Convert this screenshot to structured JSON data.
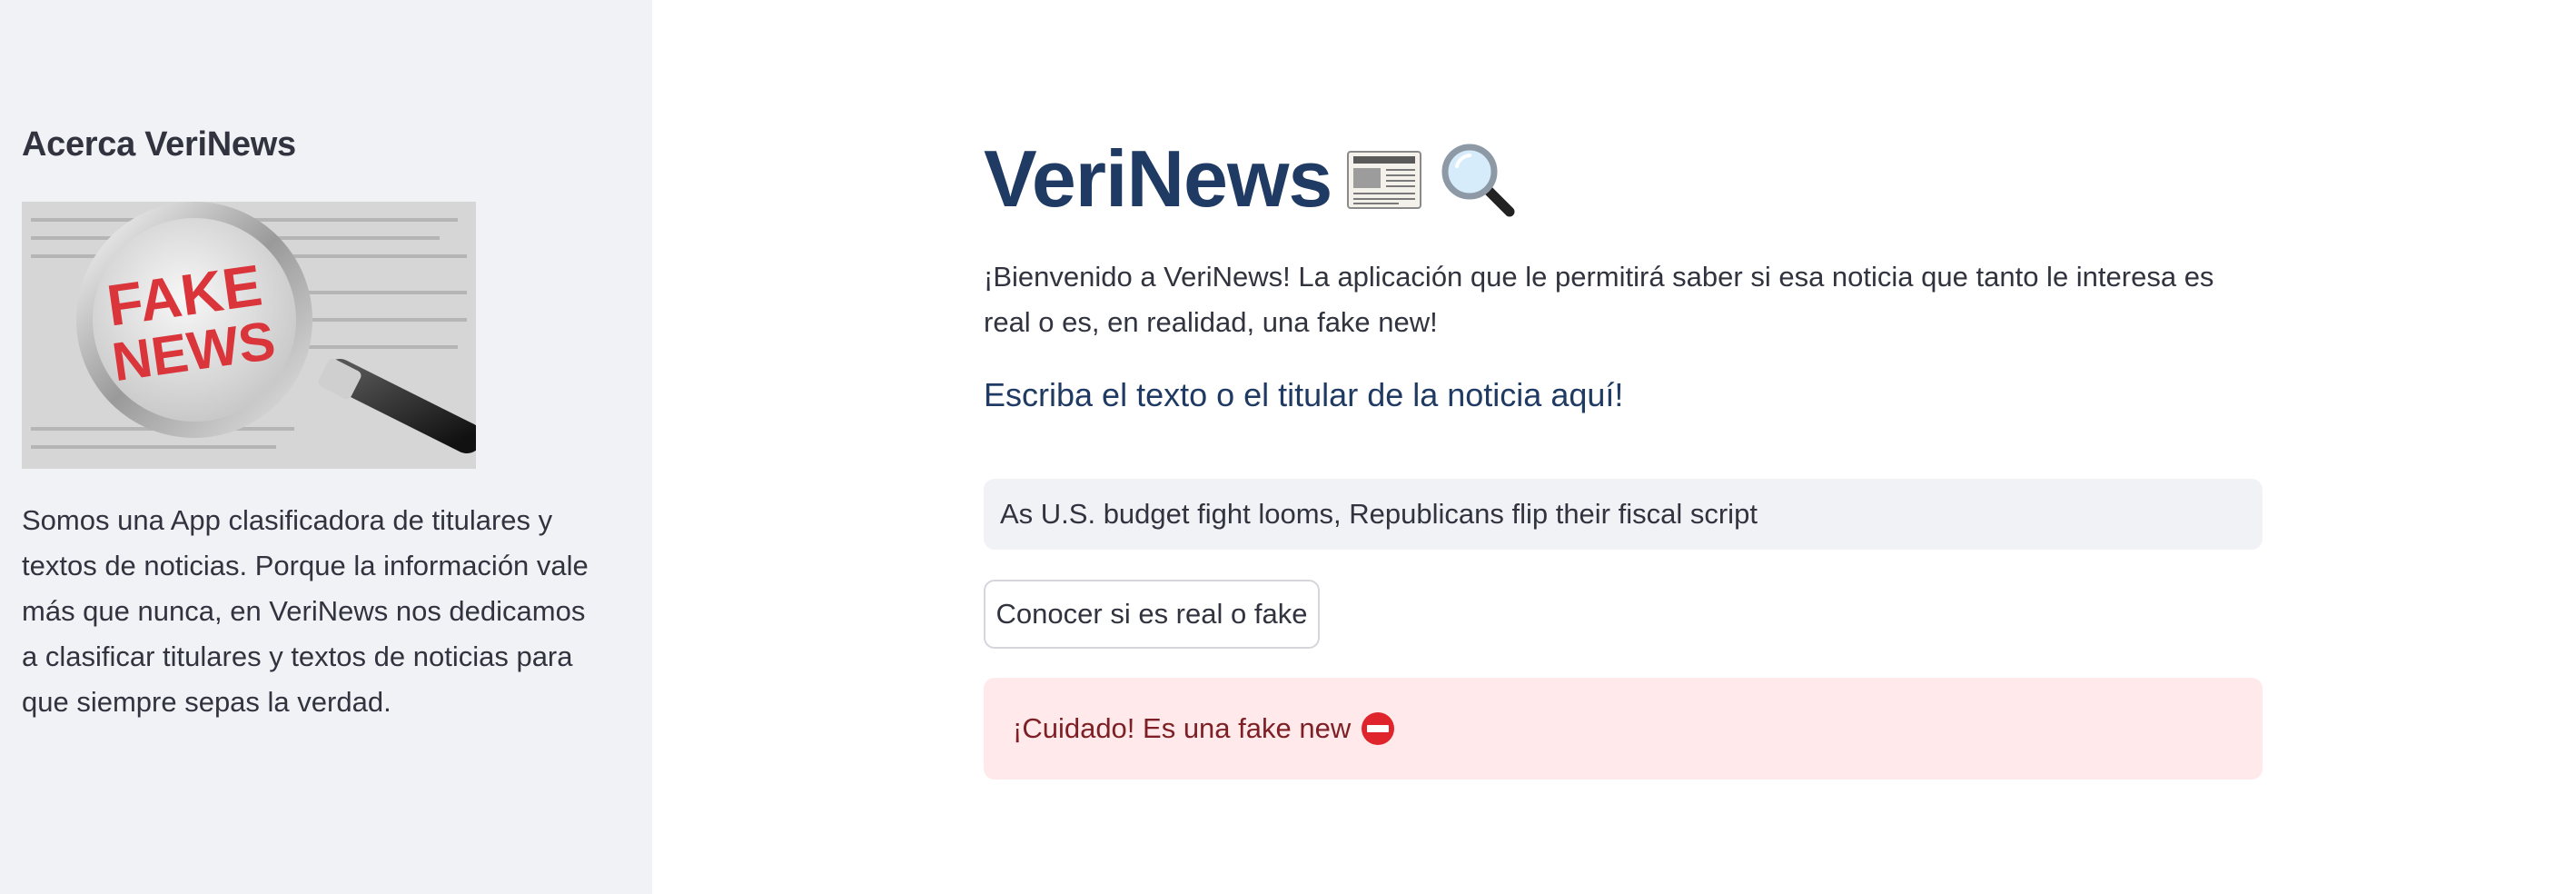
{
  "sidebar": {
    "title": "Acerca VeriNews",
    "image_text": [
      "FAKE",
      "NEWS"
    ],
    "description": "Somos una App clasificadora de titulares y textos de noticias. Porque la información vale más que nunca, en VeriNews nos dedicamos a clasificar titulares y textos de noticias para que siempre sepas la verdad."
  },
  "main": {
    "title": "VeriNews",
    "title_icons": [
      "newspaper-icon",
      "magnifying-glass-icon"
    ],
    "welcome": "¡Bienvenido a VeriNews! La aplicación que le permitirá saber si esa noticia que tanto le interesa es real o es, en realidad, una fake new!",
    "prompt": "Escriba el texto o el titular de la noticia aquí!",
    "input_value": "As U.S. budget fight looms, Republicans flip their fiscal script",
    "button_label": "Conocer si es real o fake",
    "result": {
      "text": "¡Cuidado! Es una fake new",
      "icon": "no-entry-icon",
      "status_color": "#ffe9ea"
    }
  },
  "colors": {
    "sidebar_bg": "#f0f2f6",
    "title_color": "#1f3a63",
    "text_color": "#31333f",
    "alert_text": "#7d1f24"
  }
}
